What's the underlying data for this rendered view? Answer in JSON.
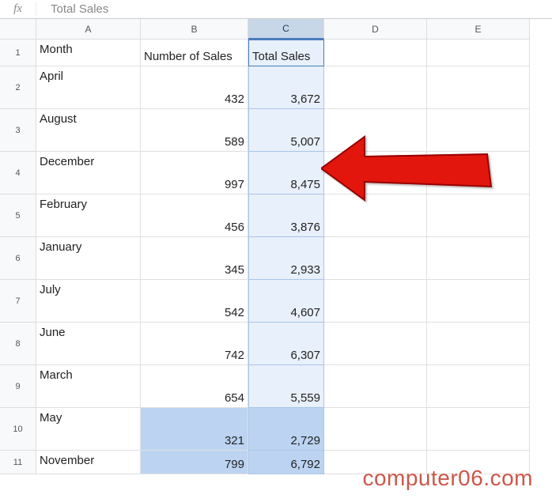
{
  "formula_bar": {
    "fx_label": "fx",
    "value": "Total Sales"
  },
  "columns": [
    {
      "letter": "A",
      "cls": "col-A"
    },
    {
      "letter": "B",
      "cls": "col-B"
    },
    {
      "letter": "C",
      "cls": "col-C",
      "selected": true
    },
    {
      "letter": "D",
      "cls": "col-D"
    },
    {
      "letter": "E",
      "cls": "col-E"
    }
  ],
  "header_row": {
    "num": "1",
    "month_label": "Month",
    "sales_count_label": "Number of Sales",
    "total_label": "Total Sales"
  },
  "rows": [
    {
      "num": "2",
      "month": "April",
      "sales": "432",
      "total": "3,672"
    },
    {
      "num": "3",
      "month": "August",
      "sales": "589",
      "total": "5,007"
    },
    {
      "num": "4",
      "month": "December",
      "sales": "997",
      "total": "8,475"
    },
    {
      "num": "5",
      "month": "February",
      "sales": "456",
      "total": "3,876"
    },
    {
      "num": "6",
      "month": "January",
      "sales": "345",
      "total": "2,933"
    },
    {
      "num": "7",
      "month": "July",
      "sales": "542",
      "total": "4,607"
    },
    {
      "num": "8",
      "month": "June",
      "sales": "742",
      "total": "6,307"
    },
    {
      "num": "9",
      "month": "March",
      "sales": "654",
      "total": "5,559"
    },
    {
      "num": "10",
      "month": "May",
      "sales": "321",
      "total": "2,729",
      "hl": true
    },
    {
      "num": "11",
      "month": "November",
      "sales": "799",
      "total": "6,792",
      "hl": true,
      "last": true
    }
  ],
  "watermark": "computer06.com",
  "chart_data": {
    "type": "table",
    "title": "",
    "columns": [
      "Month",
      "Number of Sales",
      "Total Sales"
    ],
    "rows": [
      [
        "April",
        432,
        3672
      ],
      [
        "August",
        589,
        5007
      ],
      [
        "December",
        997,
        8475
      ],
      [
        "February",
        456,
        3876
      ],
      [
        "January",
        345,
        2933
      ],
      [
        "July",
        542,
        4607
      ],
      [
        "June",
        742,
        6307
      ],
      [
        "March",
        654,
        5559
      ],
      [
        "May",
        321,
        2729
      ],
      [
        "November",
        799,
        6792
      ]
    ]
  }
}
